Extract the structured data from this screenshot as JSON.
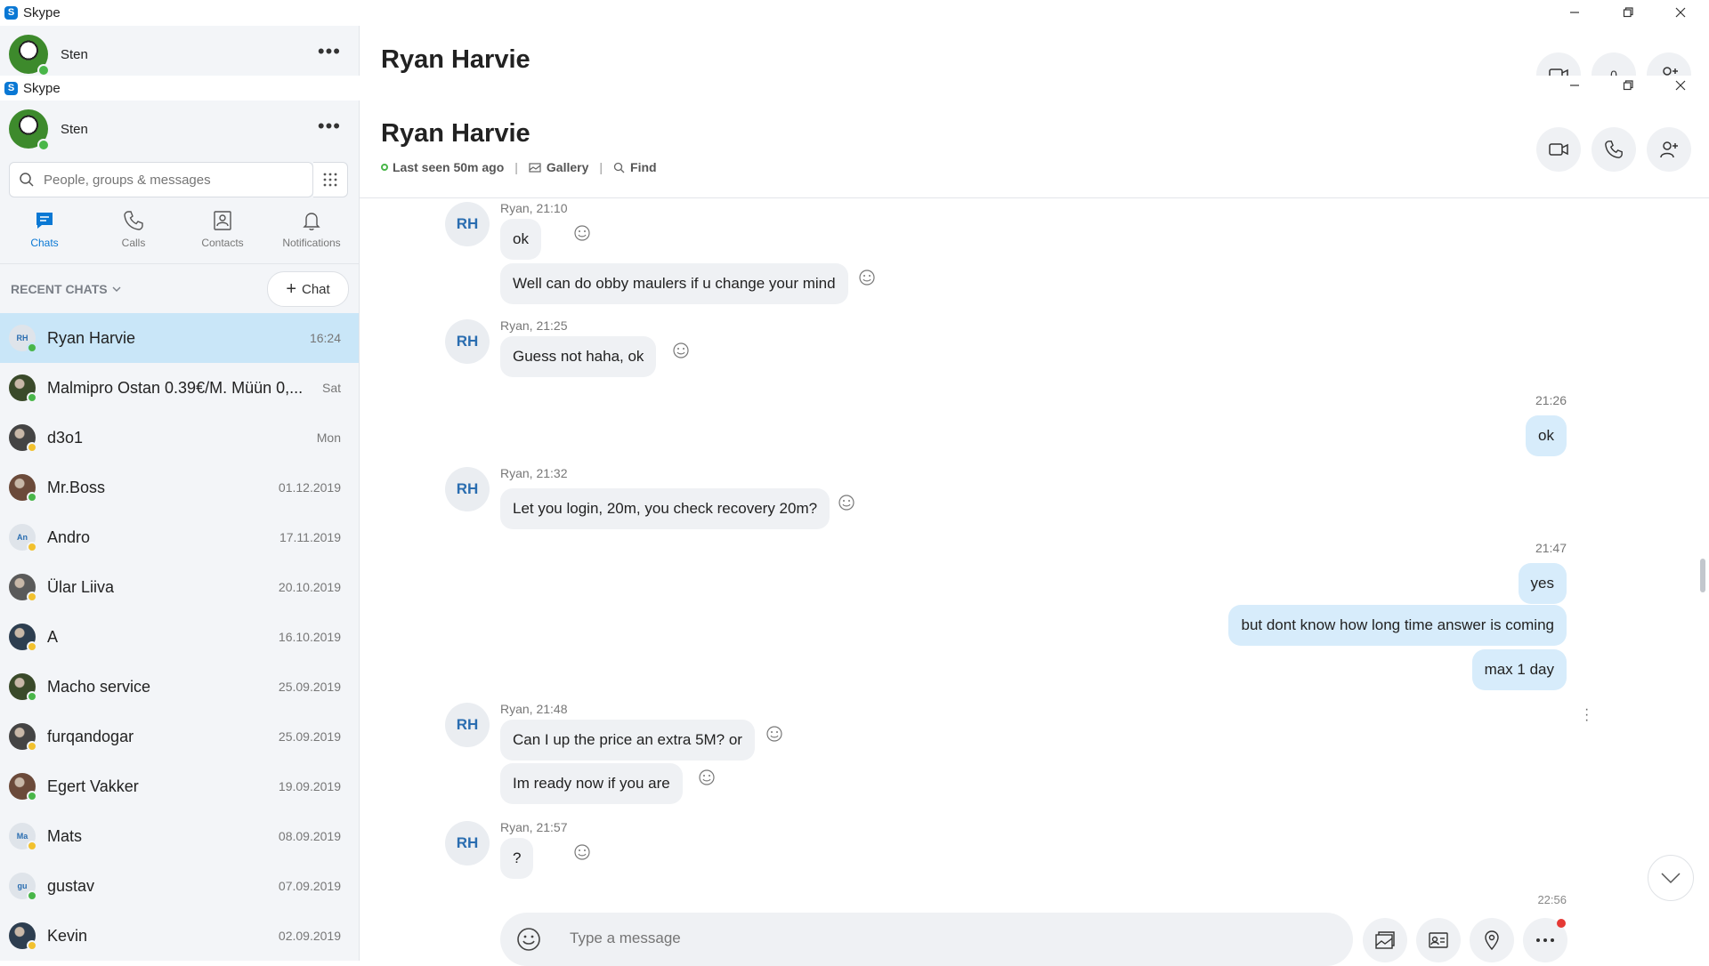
{
  "app": {
    "name": "Skype"
  },
  "profile": {
    "name": "Sten",
    "more": "•••"
  },
  "search": {
    "placeholder": "People, groups & messages"
  },
  "nav": [
    {
      "label": "Chats"
    },
    {
      "label": "Calls"
    },
    {
      "label": "Contacts"
    },
    {
      "label": "Notifications"
    }
  ],
  "recent": {
    "label": "RECENT CHATS",
    "new_chat": "Chat"
  },
  "chats": [
    {
      "name": "Ryan Harvie",
      "time": "16:24",
      "initials": "RH",
      "status": "#49b649"
    },
    {
      "name": "Malmipro Ostan 0.39€/M. Müün 0,...",
      "time": "Sat",
      "initials": "",
      "status": "#49b649"
    },
    {
      "name": "d3o1",
      "time": "Mon",
      "initials": "",
      "status": "#f2c12e"
    },
    {
      "name": "Mr.Boss",
      "time": "01.12.2019",
      "initials": "",
      "status": "#49b649"
    },
    {
      "name": "Andro",
      "time": "17.11.2019",
      "initials": "An",
      "status": "#f2c12e"
    },
    {
      "name": "Ülar Liiva",
      "time": "20.10.2019",
      "initials": "",
      "status": "#f2c12e"
    },
    {
      "name": "A",
      "time": "16.10.2019",
      "initials": "",
      "status": "#f2c12e"
    },
    {
      "name": "Macho service",
      "time": "25.09.2019",
      "initials": "",
      "status": "#49b649"
    },
    {
      "name": "furqandogar",
      "time": "25.09.2019",
      "initials": "",
      "status": "#f2c12e"
    },
    {
      "name": "Egert Vakker",
      "time": "19.09.2019",
      "initials": "",
      "status": "#49b649"
    },
    {
      "name": "Mats",
      "time": "08.09.2019",
      "initials": "Ma",
      "status": "#f2c12e"
    },
    {
      "name": "gustav",
      "time": "07.09.2019",
      "initials": "gu",
      "status": "#49b649"
    },
    {
      "name": "Kevin",
      "time": "02.09.2019",
      "initials": "",
      "status": "#f2c12e"
    }
  ],
  "conversation": {
    "title": "Ryan Harvie",
    "last_seen": "Last seen 50m ago",
    "gallery": "Gallery",
    "find": "Find",
    "initials": "RH",
    "ghost_badge": "0",
    "groups": [
      {
        "meta": "Ryan, 21:10",
        "messages": [
          "ok",
          "Well can do obby maulers if u change your mind"
        ]
      },
      {
        "meta": "Ryan, 21:25",
        "messages": [
          "Guess not haha, ok"
        ]
      },
      {
        "out_time": "21:26",
        "out_messages": [
          "ok"
        ]
      },
      {
        "meta": "Ryan, 21:32",
        "messages": [
          "Let you login, 20m, you check recovery 20m?"
        ]
      },
      {
        "out_time": "21:47",
        "out_messages": [
          "yes",
          "but dont know how long time answer is coming",
          "max 1 day"
        ]
      },
      {
        "meta": "Ryan, 21:48",
        "messages": [
          "Can I up the price an extra 5M? or",
          "Im ready now if you are"
        ]
      },
      {
        "meta": "Ryan, 21:57",
        "messages": [
          "?"
        ]
      },
      {
        "out_time": "22:56"
      }
    ]
  },
  "composer": {
    "placeholder": "Type a message"
  },
  "colors": {
    "accent": "#0a78d4",
    "active_row": "#c9e6f8",
    "outgoing": "#d7ecfb",
    "incoming": "#eff1f4",
    "online": "#49b649",
    "away": "#f2c12e"
  }
}
